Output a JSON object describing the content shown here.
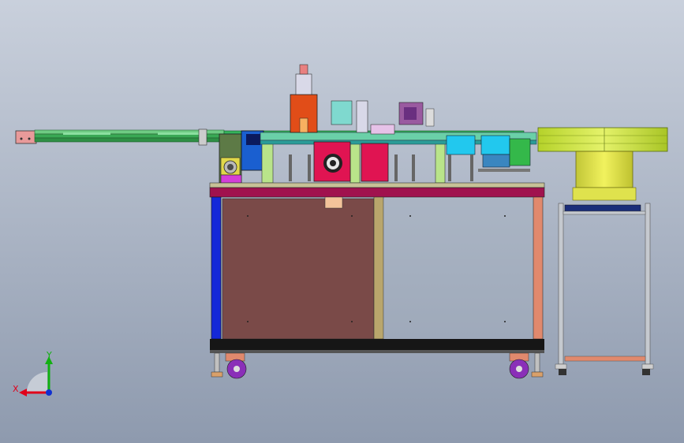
{
  "scene": {
    "background_top": "#c9d0dc",
    "background_bottom": "#8e9aae"
  },
  "triad": {
    "x_label": "X",
    "y_label": "Y",
    "x_color": "#e0001a",
    "y_color": "#12b012",
    "z_color": "#1030d0"
  },
  "colors": {
    "frame_blue": "#1428d8",
    "table_top": "#a0124e",
    "panel_brown": "#7a4a48",
    "post_tan": "#b9a66c",
    "post_salmon": "#e1896d",
    "cylinder_orange": "#e14d18",
    "cylinder_red": "#e01452",
    "bowl_lime": "#c5e335",
    "bowl_yellow": "#dfe24d",
    "conveyor_green": "#3aa855",
    "wheel_purple": "#8a2fb8",
    "cyan_block": "#22c8ee"
  }
}
